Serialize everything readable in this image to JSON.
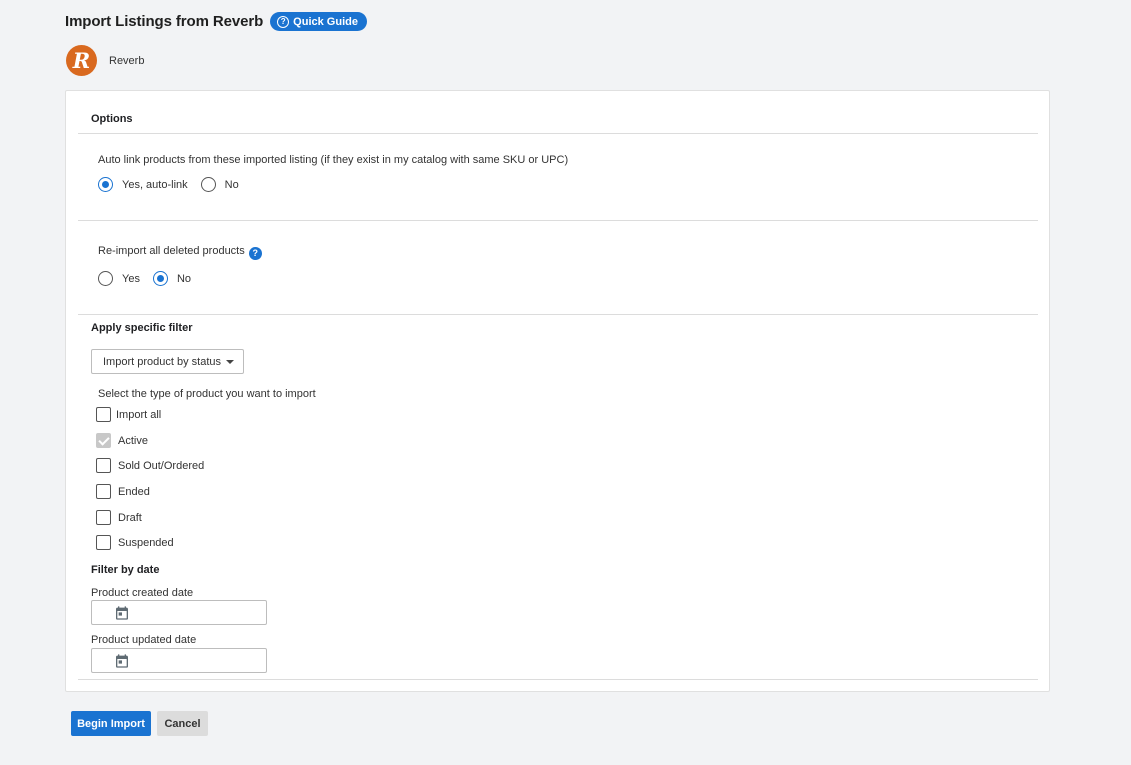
{
  "header": {
    "title": "Import Listings from Reverb",
    "quick_guide_label": "Quick Guide"
  },
  "channel": {
    "logo_letter": "R",
    "name": "Reverb"
  },
  "options": {
    "section_title": "Options",
    "auto_link": {
      "label": "Auto link products from these imported listing (if they exist in my catalog with same SKU or UPC)",
      "options": [
        {
          "label": "Yes, auto-link",
          "selected": true
        },
        {
          "label": "No",
          "selected": false
        }
      ]
    },
    "reimport": {
      "label": "Re-import all deleted products",
      "help_icon": "?",
      "options": [
        {
          "label": "Yes",
          "selected": false
        },
        {
          "label": "No",
          "selected": true
        }
      ]
    }
  },
  "filter": {
    "section_title": "Apply specific filter",
    "select_value": "Import product by status",
    "type_label": "Select the type of product you want to import",
    "checkboxes": [
      {
        "label": "Import all",
        "checked": false,
        "disabled": false
      },
      {
        "label": "Active",
        "checked": true,
        "disabled": true
      },
      {
        "label": "Sold Out/Ordered",
        "checked": false,
        "disabled": false
      },
      {
        "label": "Ended",
        "checked": false,
        "disabled": false
      },
      {
        "label": "Draft",
        "checked": false,
        "disabled": false
      },
      {
        "label": "Suspended",
        "checked": false,
        "disabled": false
      }
    ],
    "date_section_title": "Filter by date",
    "created_label": "Product created date",
    "updated_label": "Product updated date"
  },
  "actions": {
    "begin_label": "Begin Import",
    "cancel_label": "Cancel"
  },
  "colors": {
    "accent": "#1a73d1",
    "logo": "#d9691f",
    "background": "#f2f3f5"
  }
}
